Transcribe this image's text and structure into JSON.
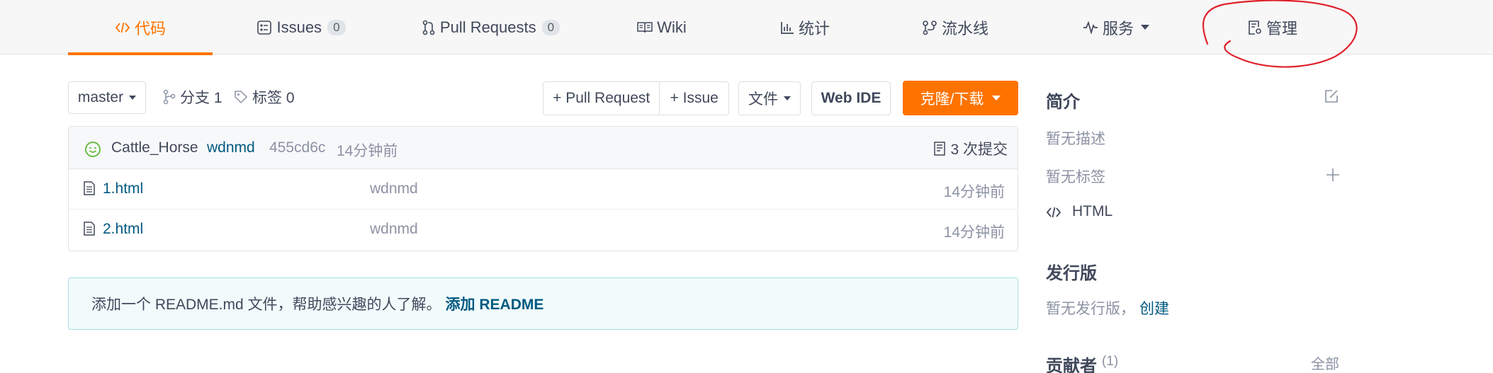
{
  "tabs": [
    {
      "label": "代码",
      "icon": "code-icon",
      "active": true
    },
    {
      "label": "Issues",
      "icon": "issues-icon",
      "count": "0"
    },
    {
      "label": "Pull Requests",
      "icon": "pull-request-icon",
      "count": "0"
    },
    {
      "label": "Wiki",
      "icon": "book-icon"
    },
    {
      "label": "统计",
      "icon": "bar-chart-icon"
    },
    {
      "label": "流水线",
      "icon": "pipeline-icon"
    },
    {
      "label": "服务",
      "icon": "pulse-icon",
      "dropdown": true
    },
    {
      "label": "管理",
      "icon": "settings-doc-icon"
    }
  ],
  "toolbar": {
    "branch": "master",
    "branches_label": "分支 1",
    "tags_label": "标签 0",
    "new_pr": "+ Pull Request",
    "new_issue": "+ Issue",
    "file_menu": "文件",
    "web_ide": "Web IDE",
    "clone": "克隆/下载"
  },
  "commit": {
    "author": "Cattle_Horse",
    "message": "wdnmd",
    "hash": "455cd6c",
    "time": "14分钟前",
    "count_label": "3 次提交"
  },
  "files": [
    {
      "name": "1.html",
      "message": "wdnmd",
      "time": "14分钟前"
    },
    {
      "name": "2.html",
      "message": "wdnmd",
      "time": "14分钟前"
    }
  ],
  "readme": {
    "text": "添加一个 README.md 文件，帮助感兴趣的人了解。",
    "action": "添加 README"
  },
  "sidebar": {
    "intro_title": "简介",
    "no_desc": "暂无描述",
    "no_tags": "暂无标签",
    "language": "HTML",
    "release_title": "发行版",
    "no_release": "暂无发行版，",
    "create": "创建",
    "contributors_title": "贡献者",
    "contributors_count": "(1)",
    "all": "全部"
  },
  "colors": {
    "accent": "#fe7300",
    "link": "#005980",
    "annotation": "#e0212b"
  }
}
